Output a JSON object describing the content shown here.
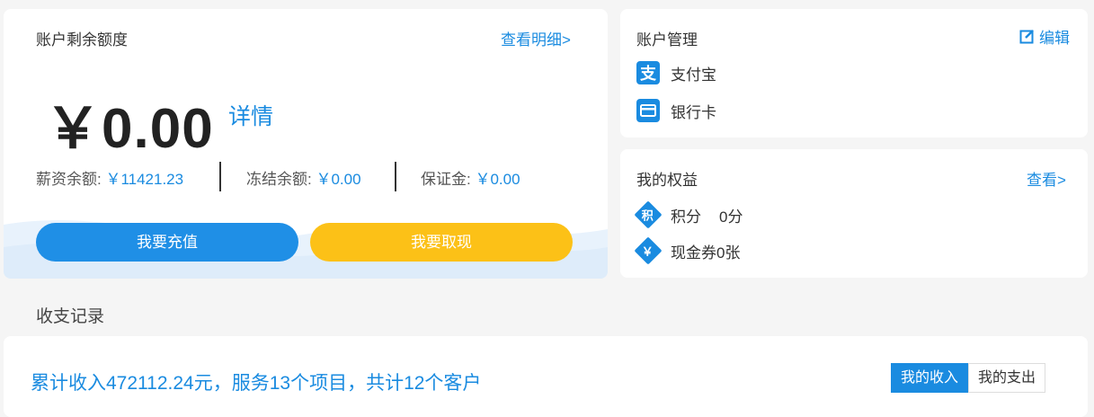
{
  "balance": {
    "title": "账户剩余额度",
    "view_detail_link": "查看明细>",
    "amount": "￥0.00",
    "detail_link": "详情",
    "salary_label": "薪资余额: ",
    "salary_value": "￥11421.23",
    "frozen_label": "冻结余额: ",
    "frozen_value": "￥0.00",
    "deposit_label": "保证金: ",
    "deposit_value": "￥0.00",
    "recharge_button": "我要充值",
    "withdraw_button": "我要取现"
  },
  "account": {
    "title": "账户管理",
    "edit_label": "编辑",
    "methods": [
      {
        "label": "支付宝",
        "icon": "alipay-icon"
      },
      {
        "label": "银行卡",
        "icon": "bank-card-icon"
      }
    ]
  },
  "rights": {
    "title": "我的权益",
    "view_link": "查看>",
    "points_label": "积分",
    "points_value": "0分",
    "coupon_label": "现金券",
    "coupon_value": "0张",
    "points_icon_glyph": "积",
    "coupon_icon_glyph": "￥"
  },
  "records": {
    "title": "收支记录",
    "summary": "累计收入472112.24元，服务13个项目，共计12个客户",
    "tabs": [
      {
        "label": "我的收入",
        "active": true
      },
      {
        "label": "我的支出",
        "active": false
      }
    ]
  },
  "colors": {
    "accent": "#1a8be0",
    "recharge": "#1f8fe6",
    "withdraw": "#fcc117",
    "background": "#f5f5f5"
  }
}
